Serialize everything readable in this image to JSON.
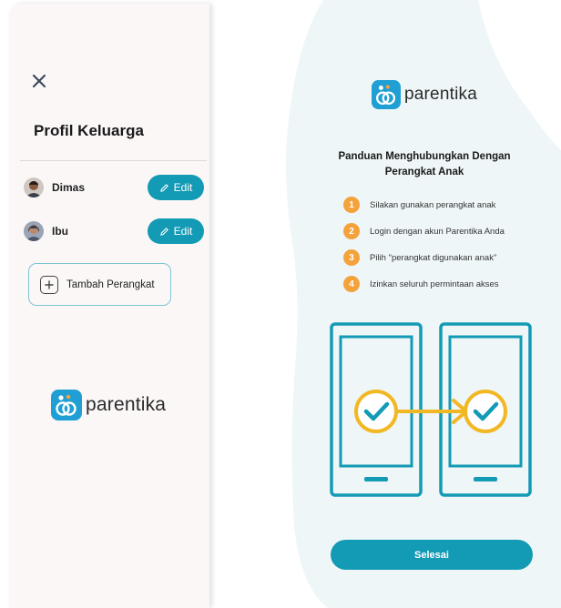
{
  "sidebar": {
    "title": "Profil Keluarga",
    "profiles": [
      {
        "name": "Dimas",
        "edit_label": "Edit"
      },
      {
        "name": "Ibu",
        "edit_label": "Edit"
      }
    ],
    "add_device_label": "Tambah Perangkat",
    "brand": "parentika"
  },
  "guide": {
    "brand": "parentika",
    "title": "Panduan Menghubungkan Dengan Perangkat Anak",
    "steps": [
      {
        "number": "1",
        "text": "Silakan gunakan perangkat anak"
      },
      {
        "number": "2",
        "text": "Login dengan akun Parentika Anda"
      },
      {
        "number": "3",
        "text": "Pilih \"perangkat digunakan anak\""
      },
      {
        "number": "4",
        "text": "Izinkan seluruh permintaan akses"
      }
    ],
    "done_label": "Selesai"
  },
  "colors": {
    "primary": "#139ab5",
    "accent_orange": "#f4a23c",
    "check_yellow": "#f2b824",
    "panel_bg": "#fbf7f7",
    "blob_bg": "#eef6f8"
  },
  "icons": {
    "close": "close-icon",
    "edit": "pencil-icon",
    "add": "plus-icon",
    "logo": "parentika-logo-icon"
  }
}
